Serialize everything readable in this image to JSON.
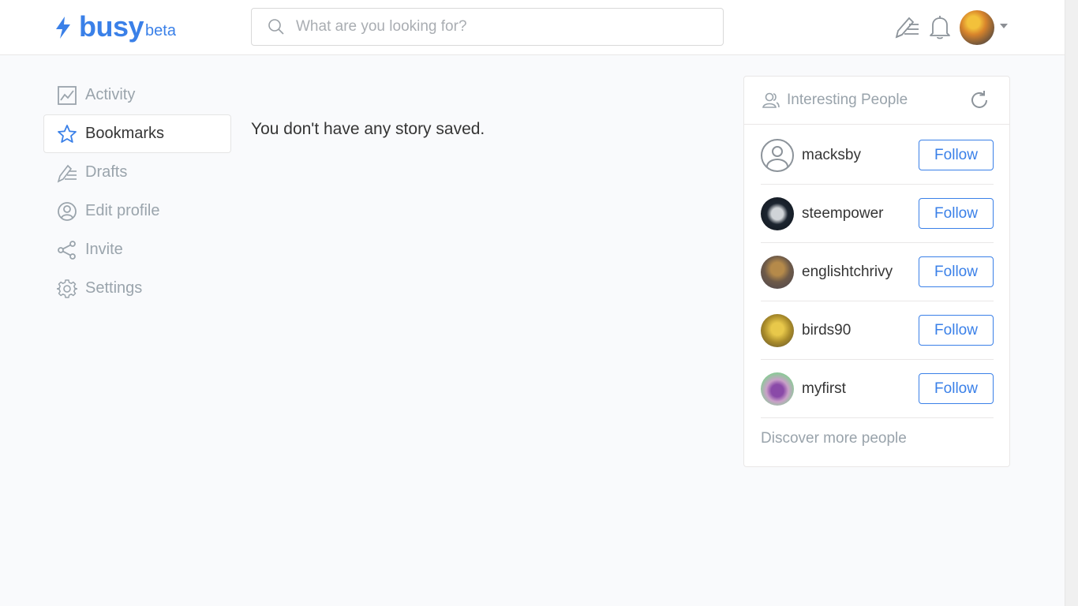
{
  "header": {
    "logo_text": "busy",
    "logo_suffix": "beta",
    "search_placeholder": "What are you looking for?"
  },
  "sidebar": {
    "items": [
      {
        "label": "Activity",
        "icon": "activity-icon"
      },
      {
        "label": "Bookmarks",
        "icon": "star-icon",
        "active": true
      },
      {
        "label": "Drafts",
        "icon": "drafts-icon"
      },
      {
        "label": "Edit profile",
        "icon": "user-circle-icon"
      },
      {
        "label": "Invite",
        "icon": "share-icon"
      },
      {
        "label": "Settings",
        "icon": "gear-icon"
      }
    ]
  },
  "main": {
    "empty_message": "You don't have any story saved."
  },
  "interesting_people": {
    "title": "Interesting People",
    "people": [
      {
        "name": "macksby",
        "button": "Follow"
      },
      {
        "name": "steempower",
        "button": "Follow"
      },
      {
        "name": "englishtchrivy",
        "button": "Follow"
      },
      {
        "name": "birds90",
        "button": "Follow"
      },
      {
        "name": "myfirst",
        "button": "Follow"
      }
    ],
    "discover_link": "Discover more people"
  },
  "colors": {
    "accent": "#3a80e8",
    "muted_text": "#9aa4ac",
    "background": "#f9fafc"
  }
}
